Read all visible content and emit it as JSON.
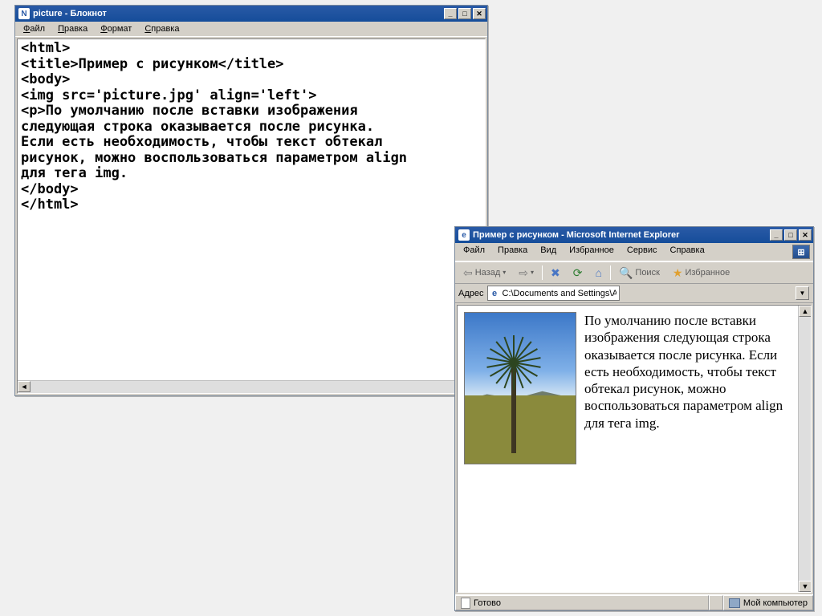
{
  "notepad": {
    "title": "picture - Блокнот",
    "menu": {
      "file": "Файл",
      "edit": "Правка",
      "format": "Формат",
      "help": "Справка"
    },
    "code": "<html>\n<title>Пример с рисунком</title>\n<body>\n<img src='picture.jpg' align='left'>\n<p>По умолчанию после вставки изображения\nследующая строка оказывается после рисунка.\nЕсли есть необходимость, чтобы текст обтекал\nрисунок, можно воспользоваться параметром align\nдля тега img.\n</body>\n</html>"
  },
  "ie": {
    "title": "Пример с рисунком - Microsoft Internet Explorer",
    "menu": {
      "file": "Файл",
      "edit": "Правка",
      "view": "Вид",
      "fav": "Избранное",
      "tools": "Сервис",
      "help": "Справка"
    },
    "toolbar": {
      "back": "Назад",
      "search": "Поиск",
      "favorites": "Избранное"
    },
    "addressLabel": "Адрес",
    "addressValue": "C:\\Documents and Settings\\Администратор\\Рабочий стол",
    "body": "По умолчанию после вставки изображения следующая строка оказывается после рисунка. Если есть необходимость, чтобы текст обтекал рисунок, можно воспользоваться параметром align для тега img.",
    "status": {
      "ready": "Готово",
      "zone": "Мой компьютер"
    }
  }
}
